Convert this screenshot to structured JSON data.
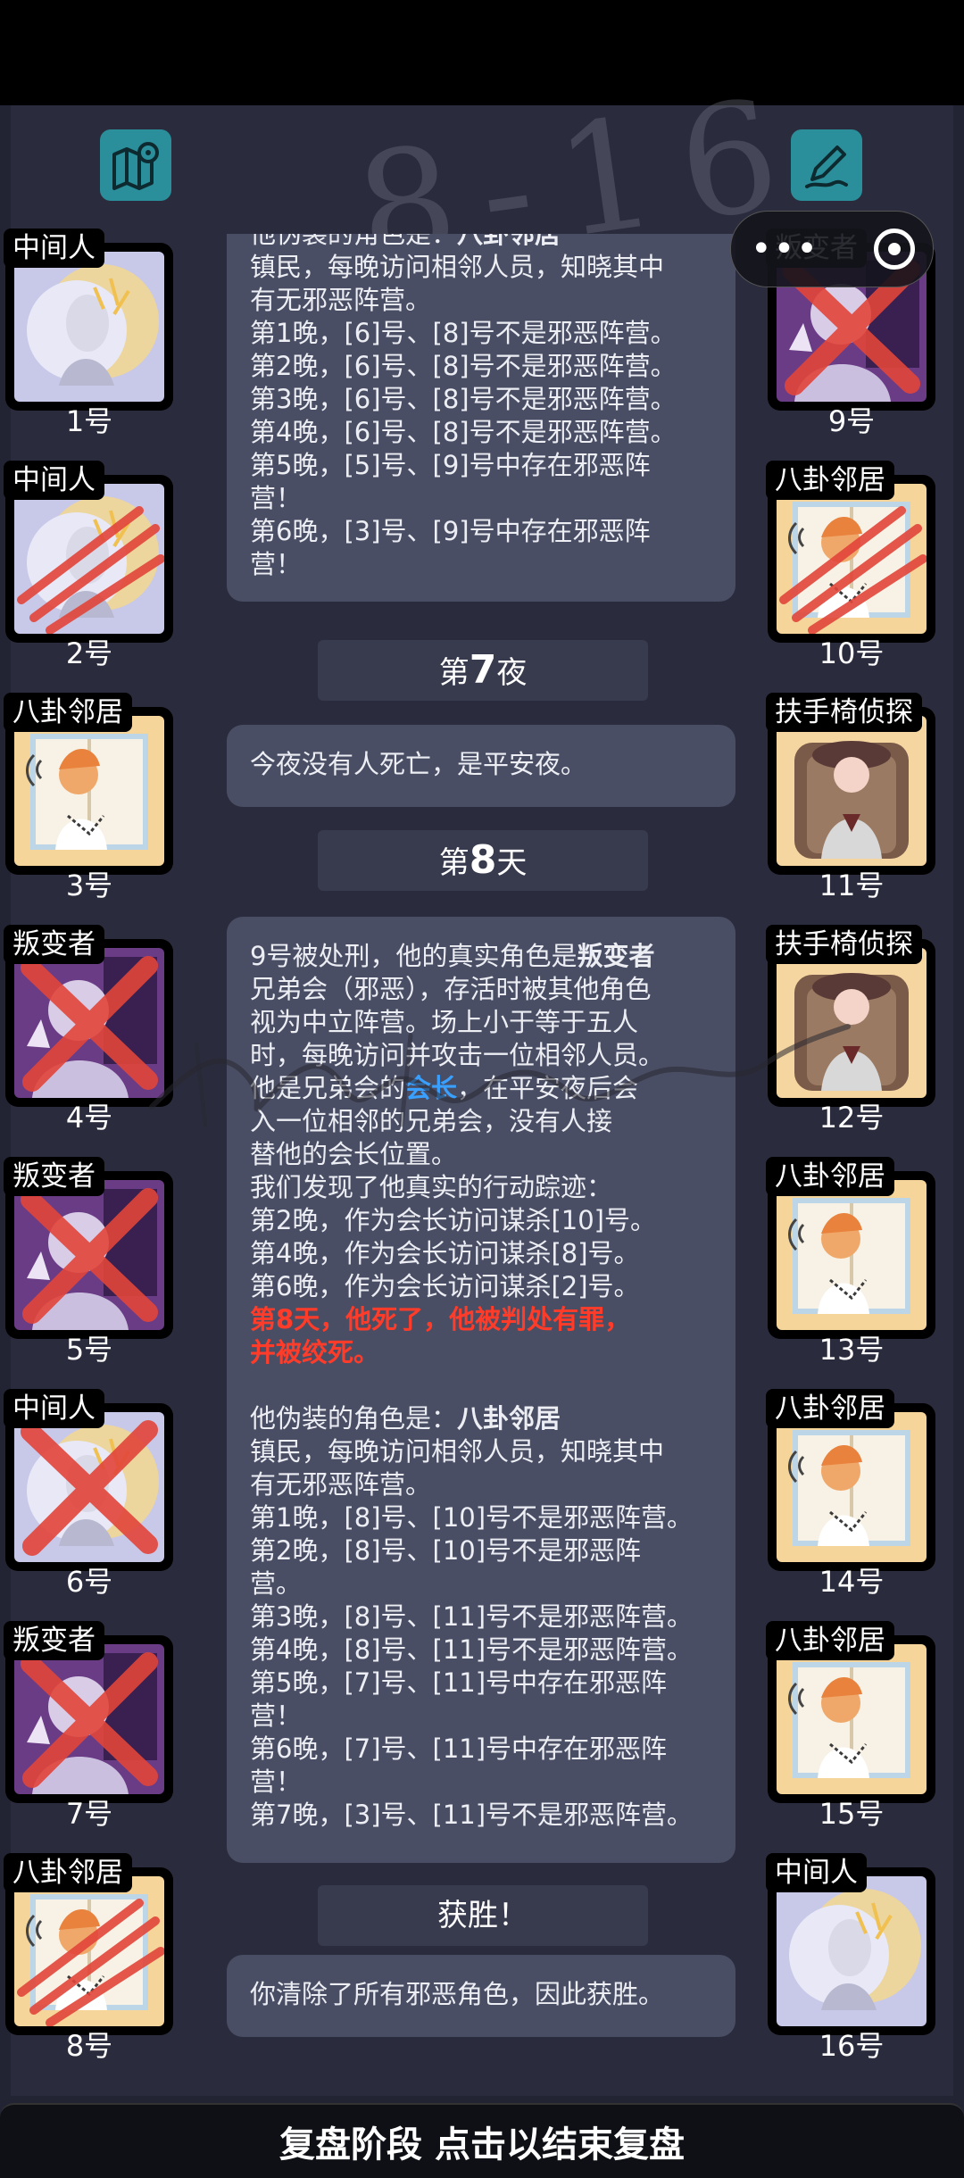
{
  "roles": {
    "middle": "中间人",
    "traitor": "叛变者",
    "gossip": "八卦邻居",
    "armchair": "扶手椅侦探"
  },
  "icons": {
    "left": "map-pin-icon",
    "right": "pen-edit-icon"
  },
  "watermark": "8-16",
  "left_players": [
    {
      "role": "中间人",
      "number": "1号",
      "art": "middle",
      "mark": "none"
    },
    {
      "role": "中间人",
      "number": "2号",
      "art": "middle",
      "mark": "claw"
    },
    {
      "role": "八卦邻居",
      "number": "3号",
      "art": "gossip",
      "mark": "none"
    },
    {
      "role": "叛变者",
      "number": "4号",
      "art": "traitor",
      "mark": "cross"
    },
    {
      "role": "叛变者",
      "number": "5号",
      "art": "traitor",
      "mark": "cross"
    },
    {
      "role": "中间人",
      "number": "6号",
      "art": "middle",
      "mark": "cross"
    },
    {
      "role": "叛变者",
      "number": "7号",
      "art": "traitor",
      "mark": "cross"
    },
    {
      "role": "八卦邻居",
      "number": "8号",
      "art": "gossip",
      "mark": "claw"
    }
  ],
  "right_players": [
    {
      "role": "叛变者",
      "number": "9号",
      "art": "traitor",
      "mark": "cross"
    },
    {
      "role": "八卦邻居",
      "number": "10号",
      "art": "gossip",
      "mark": "claw"
    },
    {
      "role": "扶手椅侦探",
      "number": "11号",
      "art": "armchair",
      "mark": "none"
    },
    {
      "role": "扶手椅侦探",
      "number": "12号",
      "art": "armchair",
      "mark": "none"
    },
    {
      "role": "八卦邻居",
      "number": "13号",
      "art": "gossip",
      "mark": "none"
    },
    {
      "role": "八卦邻居",
      "number": "14号",
      "art": "gossip",
      "mark": "none"
    },
    {
      "role": "八卦邻居",
      "number": "15号",
      "art": "gossip",
      "mark": "none"
    },
    {
      "role": "中间人",
      "number": "16号",
      "art": "middle",
      "mark": "none"
    }
  ],
  "log": {
    "b1": {
      "l1_prefix": "他伪装的角色是：",
      "l1_role": "八卦邻居",
      "l2": "镇民，每晚访问相邻人员，知晓其中",
      "l3": "有无邪恶阵营。",
      "l4": "第1晚，[6]号、[8]号不是邪恶阵营。",
      "l5": "第2晚，[6]号、[8]号不是邪恶阵营。",
      "l6": "第3晚，[6]号、[8]号不是邪恶阵营。",
      "l7": "第4晚，[6]号、[8]号不是邪恶阵营。",
      "l8": "第5晚，[5]号、[9]号中存在邪恶阵",
      "l9": "营！",
      "l10": "第6晚，[3]号、[9]号中存在邪恶阵",
      "l11": "营！"
    },
    "h1": {
      "pre": "第",
      "num": "7",
      "post": "夜"
    },
    "b2": {
      "l1": "今夜没有人死亡，是平安夜。"
    },
    "h2": {
      "pre": "第",
      "num": "8",
      "post": "天"
    },
    "b3": {
      "l1_prefix": "9号被处刑，他的真实角色是",
      "l1_role": "叛变者",
      "l2": "兄弟会（邪恶），存活时被其他角色",
      "l3": "视为中立阵营。场上小于等于五人",
      "l4": "时，每晚访问并攻击一位相邻人员。",
      "l5_a": "他是兄弟会的",
      "l5_b": "会长",
      "l5_c": "，在平安夜后会",
      "l6": "入一位相邻的兄弟会，没有人接",
      "l7": "替他的会长位置。",
      "l8": "我们发现了他真实的行动踪迹：",
      "l9": "第2晚，作为会长访问谋杀[10]号。",
      "l10": "第4晚，作为会长访问谋杀[8]号。",
      "l11": "第6晚，作为会长访问谋杀[2]号。",
      "l12": "第8天，他死了，他被判处有罪，",
      "l13": "并被绞死。",
      "l14_prefix": "他伪装的角色是：",
      "l14_role": "八卦邻居",
      "l15": "镇民，每晚访问相邻人员，知晓其中",
      "l16": "有无邪恶阵营。",
      "l17": "第1晚，[8]号、[10]号不是邪恶阵营。",
      "l18": "第2晚，[8]号、[10]号不是邪恶阵",
      "l19": "营。",
      "l20": "第3晚，[8]号、[11]号不是邪恶阵营。",
      "l21": "第4晚，[8]号、[11]号不是邪恶阵营。",
      "l22": "第5晚，[7]号、[11]号中存在邪恶阵",
      "l23": "营！",
      "l24": "第6晚，[7]号、[11]号中存在邪恶阵",
      "l25": "营！",
      "l26": "第7晚，[3]号、[11]号不是邪恶阵营。"
    },
    "h3": {
      "label": "获胜！"
    },
    "b4": {
      "l1": "你清除了所有邪恶角色，因此获胜。"
    }
  },
  "footer": {
    "label": "复盘阶段 点击以结束复盘"
  },
  "colors": {
    "accent_red": "#ff3c2a",
    "accent_blue": "#3aa0ff",
    "icon_teal": "#2a8f9a"
  }
}
